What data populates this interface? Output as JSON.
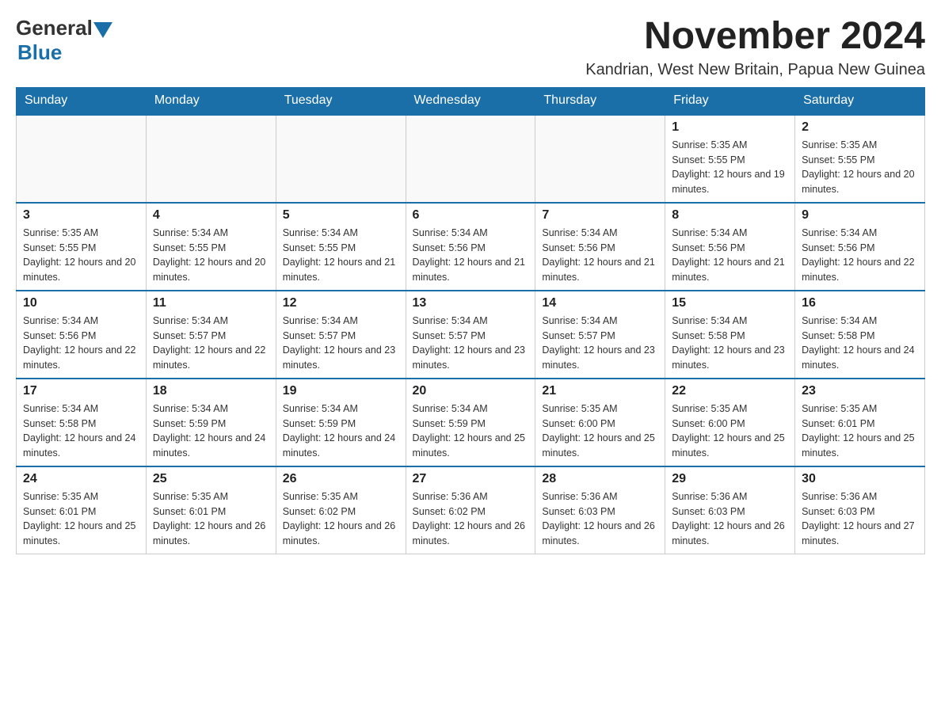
{
  "logo": {
    "general": "General",
    "blue": "Blue"
  },
  "header": {
    "month_year": "November 2024",
    "location": "Kandrian, West New Britain, Papua New Guinea"
  },
  "days_of_week": [
    "Sunday",
    "Monday",
    "Tuesday",
    "Wednesday",
    "Thursday",
    "Friday",
    "Saturday"
  ],
  "weeks": [
    [
      {
        "day": "",
        "info": ""
      },
      {
        "day": "",
        "info": ""
      },
      {
        "day": "",
        "info": ""
      },
      {
        "day": "",
        "info": ""
      },
      {
        "day": "",
        "info": ""
      },
      {
        "day": "1",
        "info": "Sunrise: 5:35 AM\nSunset: 5:55 PM\nDaylight: 12 hours and 19 minutes."
      },
      {
        "day": "2",
        "info": "Sunrise: 5:35 AM\nSunset: 5:55 PM\nDaylight: 12 hours and 20 minutes."
      }
    ],
    [
      {
        "day": "3",
        "info": "Sunrise: 5:35 AM\nSunset: 5:55 PM\nDaylight: 12 hours and 20 minutes."
      },
      {
        "day": "4",
        "info": "Sunrise: 5:34 AM\nSunset: 5:55 PM\nDaylight: 12 hours and 20 minutes."
      },
      {
        "day": "5",
        "info": "Sunrise: 5:34 AM\nSunset: 5:55 PM\nDaylight: 12 hours and 21 minutes."
      },
      {
        "day": "6",
        "info": "Sunrise: 5:34 AM\nSunset: 5:56 PM\nDaylight: 12 hours and 21 minutes."
      },
      {
        "day": "7",
        "info": "Sunrise: 5:34 AM\nSunset: 5:56 PM\nDaylight: 12 hours and 21 minutes."
      },
      {
        "day": "8",
        "info": "Sunrise: 5:34 AM\nSunset: 5:56 PM\nDaylight: 12 hours and 21 minutes."
      },
      {
        "day": "9",
        "info": "Sunrise: 5:34 AM\nSunset: 5:56 PM\nDaylight: 12 hours and 22 minutes."
      }
    ],
    [
      {
        "day": "10",
        "info": "Sunrise: 5:34 AM\nSunset: 5:56 PM\nDaylight: 12 hours and 22 minutes."
      },
      {
        "day": "11",
        "info": "Sunrise: 5:34 AM\nSunset: 5:57 PM\nDaylight: 12 hours and 22 minutes."
      },
      {
        "day": "12",
        "info": "Sunrise: 5:34 AM\nSunset: 5:57 PM\nDaylight: 12 hours and 23 minutes."
      },
      {
        "day": "13",
        "info": "Sunrise: 5:34 AM\nSunset: 5:57 PM\nDaylight: 12 hours and 23 minutes."
      },
      {
        "day": "14",
        "info": "Sunrise: 5:34 AM\nSunset: 5:57 PM\nDaylight: 12 hours and 23 minutes."
      },
      {
        "day": "15",
        "info": "Sunrise: 5:34 AM\nSunset: 5:58 PM\nDaylight: 12 hours and 23 minutes."
      },
      {
        "day": "16",
        "info": "Sunrise: 5:34 AM\nSunset: 5:58 PM\nDaylight: 12 hours and 24 minutes."
      }
    ],
    [
      {
        "day": "17",
        "info": "Sunrise: 5:34 AM\nSunset: 5:58 PM\nDaylight: 12 hours and 24 minutes."
      },
      {
        "day": "18",
        "info": "Sunrise: 5:34 AM\nSunset: 5:59 PM\nDaylight: 12 hours and 24 minutes."
      },
      {
        "day": "19",
        "info": "Sunrise: 5:34 AM\nSunset: 5:59 PM\nDaylight: 12 hours and 24 minutes."
      },
      {
        "day": "20",
        "info": "Sunrise: 5:34 AM\nSunset: 5:59 PM\nDaylight: 12 hours and 25 minutes."
      },
      {
        "day": "21",
        "info": "Sunrise: 5:35 AM\nSunset: 6:00 PM\nDaylight: 12 hours and 25 minutes."
      },
      {
        "day": "22",
        "info": "Sunrise: 5:35 AM\nSunset: 6:00 PM\nDaylight: 12 hours and 25 minutes."
      },
      {
        "day": "23",
        "info": "Sunrise: 5:35 AM\nSunset: 6:01 PM\nDaylight: 12 hours and 25 minutes."
      }
    ],
    [
      {
        "day": "24",
        "info": "Sunrise: 5:35 AM\nSunset: 6:01 PM\nDaylight: 12 hours and 25 minutes."
      },
      {
        "day": "25",
        "info": "Sunrise: 5:35 AM\nSunset: 6:01 PM\nDaylight: 12 hours and 26 minutes."
      },
      {
        "day": "26",
        "info": "Sunrise: 5:35 AM\nSunset: 6:02 PM\nDaylight: 12 hours and 26 minutes."
      },
      {
        "day": "27",
        "info": "Sunrise: 5:36 AM\nSunset: 6:02 PM\nDaylight: 12 hours and 26 minutes."
      },
      {
        "day": "28",
        "info": "Sunrise: 5:36 AM\nSunset: 6:03 PM\nDaylight: 12 hours and 26 minutes."
      },
      {
        "day": "29",
        "info": "Sunrise: 5:36 AM\nSunset: 6:03 PM\nDaylight: 12 hours and 26 minutes."
      },
      {
        "day": "30",
        "info": "Sunrise: 5:36 AM\nSunset: 6:03 PM\nDaylight: 12 hours and 27 minutes."
      }
    ]
  ]
}
